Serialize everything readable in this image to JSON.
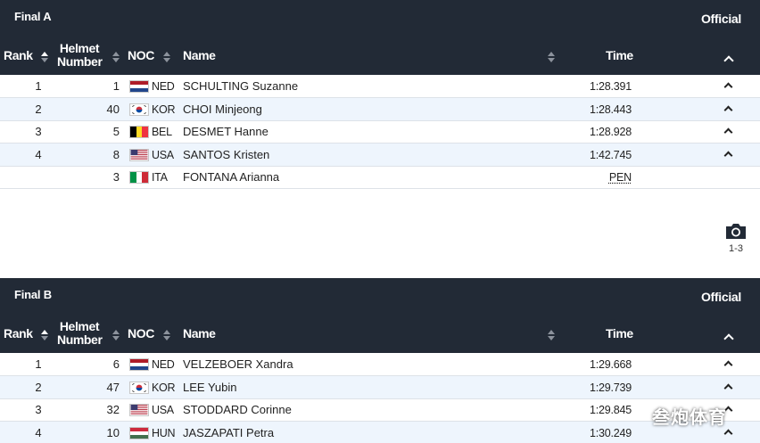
{
  "sections": [
    {
      "title": "Final A",
      "status": "Official",
      "columns": {
        "rank": "Rank",
        "helmet_l1": "Helmet",
        "helmet_l2": "Number",
        "noc": "NOC",
        "name": "Name",
        "time": "Time"
      },
      "rows": [
        {
          "rank": "1",
          "helmet": "1",
          "noc": "NED",
          "flag": "ned",
          "name": "SCHULTING Suzanne",
          "time": "1:28.391"
        },
        {
          "rank": "2",
          "helmet": "40",
          "noc": "KOR",
          "flag": "kor",
          "name": "CHOI Minjeong",
          "time": "1:28.443"
        },
        {
          "rank": "3",
          "helmet": "5",
          "noc": "BEL",
          "flag": "bel",
          "name": "DESMET Hanne",
          "time": "1:28.928"
        },
        {
          "rank": "4",
          "helmet": "8",
          "noc": "USA",
          "flag": "usa",
          "name": "SANTOS Kristen",
          "time": "1:42.745"
        },
        {
          "rank": "",
          "helmet": "3",
          "noc": "ITA",
          "flag": "ita",
          "name": "FONTANA Arianna",
          "time": "PEN"
        }
      ]
    },
    {
      "title": "Final B",
      "status": "Official",
      "columns": {
        "rank": "Rank",
        "helmet_l1": "Helmet",
        "helmet_l2": "Number",
        "noc": "NOC",
        "name": "Name",
        "time": "Time"
      },
      "rows": [
        {
          "rank": "1",
          "helmet": "6",
          "noc": "NED",
          "flag": "ned",
          "name": "VELZEBOER Xandra",
          "time": "1:29.668"
        },
        {
          "rank": "2",
          "helmet": "47",
          "noc": "KOR",
          "flag": "kor",
          "name": "LEE Yubin",
          "time": "1:29.739"
        },
        {
          "rank": "3",
          "helmet": "32",
          "noc": "USA",
          "flag": "usa",
          "name": "STODDARD Corinne",
          "time": "1:29.845"
        },
        {
          "rank": "4",
          "helmet": "10",
          "noc": "HUN",
          "flag": "hun",
          "name": "JASZAPATI Petra",
          "time": "1:30.249"
        }
      ]
    }
  ],
  "photo": {
    "icon": "camera-icon",
    "label": "1-3"
  },
  "watermark": "叁炮体育",
  "colors": {
    "header_bg": "#222a36",
    "alt_row": "#eef5fd"
  }
}
